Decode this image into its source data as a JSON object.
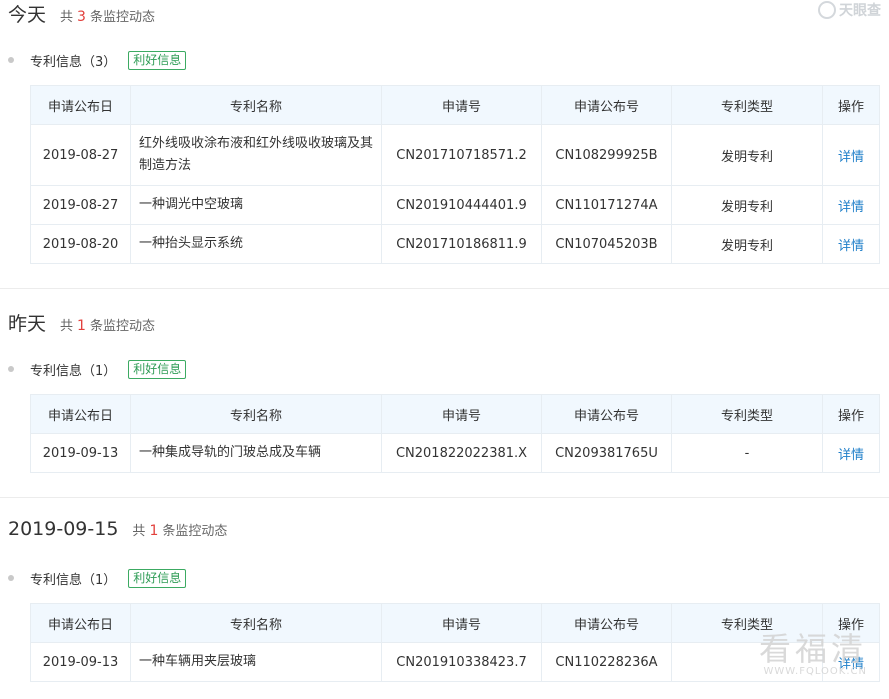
{
  "brand": {
    "logo_text": "天眼查"
  },
  "sections": [
    {
      "date": "今天",
      "count_prefix": "共",
      "count": "3",
      "count_suffix": "条监控动态",
      "category": "专利信息（3）",
      "tag": "利好信息",
      "headers": [
        "申请公布日",
        "专利名称",
        "申请号",
        "申请公布号",
        "专利类型",
        "操作"
      ],
      "rows": [
        [
          "2019-08-27",
          "红外线吸收涂布液和红外线吸收玻璃及其制造方法",
          "CN201710718571.2",
          "CN108299925B",
          "发明专利",
          "详情"
        ],
        [
          "2019-08-27",
          "一种调光中空玻璃",
          "CN201910444401.9",
          "CN110171274A",
          "发明专利",
          "详情"
        ],
        [
          "2019-08-20",
          "一种抬头显示系统",
          "CN201710186811.9",
          "CN107045203B",
          "发明专利",
          "详情"
        ]
      ]
    },
    {
      "date": "昨天",
      "count_prefix": "共",
      "count": "1",
      "count_suffix": "条监控动态",
      "category": "专利信息（1）",
      "tag": "利好信息",
      "headers": [
        "申请公布日",
        "专利名称",
        "申请号",
        "申请公布号",
        "专利类型",
        "操作"
      ],
      "rows": [
        [
          "2019-09-13",
          "一种集成导轨的门玻总成及车辆",
          "CN201822022381.X",
          "CN209381765U",
          "-",
          "详情"
        ]
      ]
    },
    {
      "date": "2019-09-15",
      "count_prefix": "共",
      "count": "1",
      "count_suffix": "条监控动态",
      "category": "专利信息（1）",
      "tag": "利好信息",
      "headers": [
        "申请公布日",
        "专利名称",
        "申请号",
        "申请公布号",
        "专利类型",
        "操作"
      ],
      "rows": [
        [
          "2019-09-13",
          "一种车辆用夹层玻璃",
          "CN201910338423.7",
          "CN110228236A",
          "",
          "详情"
        ]
      ]
    }
  ],
  "watermark": {
    "main": "看福清",
    "url": "WWW.FQLOOK.CN"
  }
}
